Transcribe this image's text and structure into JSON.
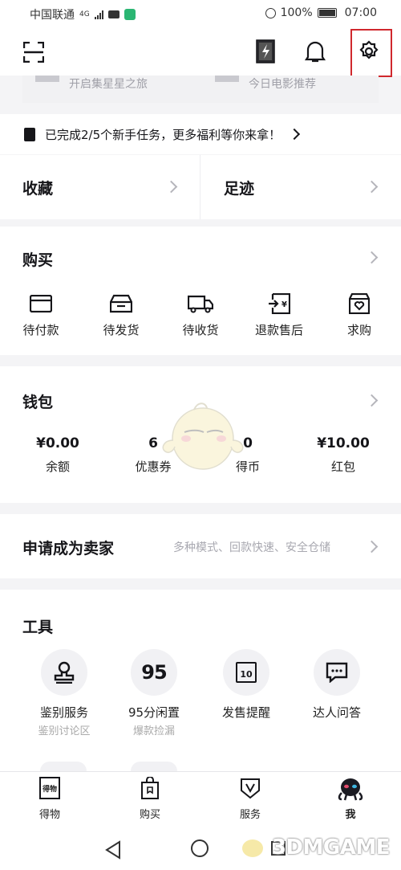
{
  "status_bar": {
    "carrier": "中国联通",
    "network": "4G",
    "battery": "100%",
    "time": "07:00"
  },
  "header": {
    "scan_icon": "scan-icon",
    "flash_icon": "flash-card-icon",
    "bell_icon": "bell-icon",
    "settings_icon": "gear-icon",
    "highlight_color": "#d0282d"
  },
  "banner_peek": {
    "left": "开启集星星之旅",
    "right": "今日电影推荐"
  },
  "task_bar": {
    "text": "已完成2/5个新手任务，更多福利等你来拿！"
  },
  "favorites": {
    "label": "收藏"
  },
  "footprints": {
    "label": "足迹"
  },
  "purchase": {
    "title": "购买",
    "items": [
      {
        "label": "待付款",
        "icon": "wallet-card-icon"
      },
      {
        "label": "待发货",
        "icon": "box-icon"
      },
      {
        "label": "待收货",
        "icon": "truck-icon"
      },
      {
        "label": "退款售后",
        "icon": "refund-icon"
      },
      {
        "label": "求购",
        "icon": "bag-heart-icon"
      }
    ]
  },
  "wallet": {
    "title": "钱包",
    "items": [
      {
        "value": "¥0.00",
        "label": "余额"
      },
      {
        "value": "6",
        "label": "优惠券"
      },
      {
        "value": "0",
        "label": "得币"
      },
      {
        "value": "¥10.00",
        "label": "红包"
      }
    ]
  },
  "seller": {
    "title": "申请成为卖家",
    "desc": "多种模式、回款快速、安全仓储"
  },
  "tools": {
    "title": "工具",
    "items": [
      {
        "label": "鉴别服务",
        "sub": "鉴别讨论区",
        "icon": "stamp-icon"
      },
      {
        "label": "95分闲置",
        "sub": "爆款捡漏",
        "icon": "95-icon",
        "icon_text": "95"
      },
      {
        "label": "发售提醒",
        "sub": "",
        "icon": "calendar-icon",
        "icon_text": "10"
      },
      {
        "label": "达人问答",
        "sub": "",
        "icon": "chat-icon"
      }
    ]
  },
  "tab_bar": {
    "tabs": [
      {
        "label": "得物",
        "icon": "dewu-icon",
        "icon_text": "得物"
      },
      {
        "label": "购买",
        "icon": "shopping-bag-icon"
      },
      {
        "label": "服务",
        "icon": "shield-v-icon"
      },
      {
        "label": "我",
        "icon": "avatar-icon"
      }
    ]
  },
  "watermark": {
    "text": "3DMGAME"
  }
}
